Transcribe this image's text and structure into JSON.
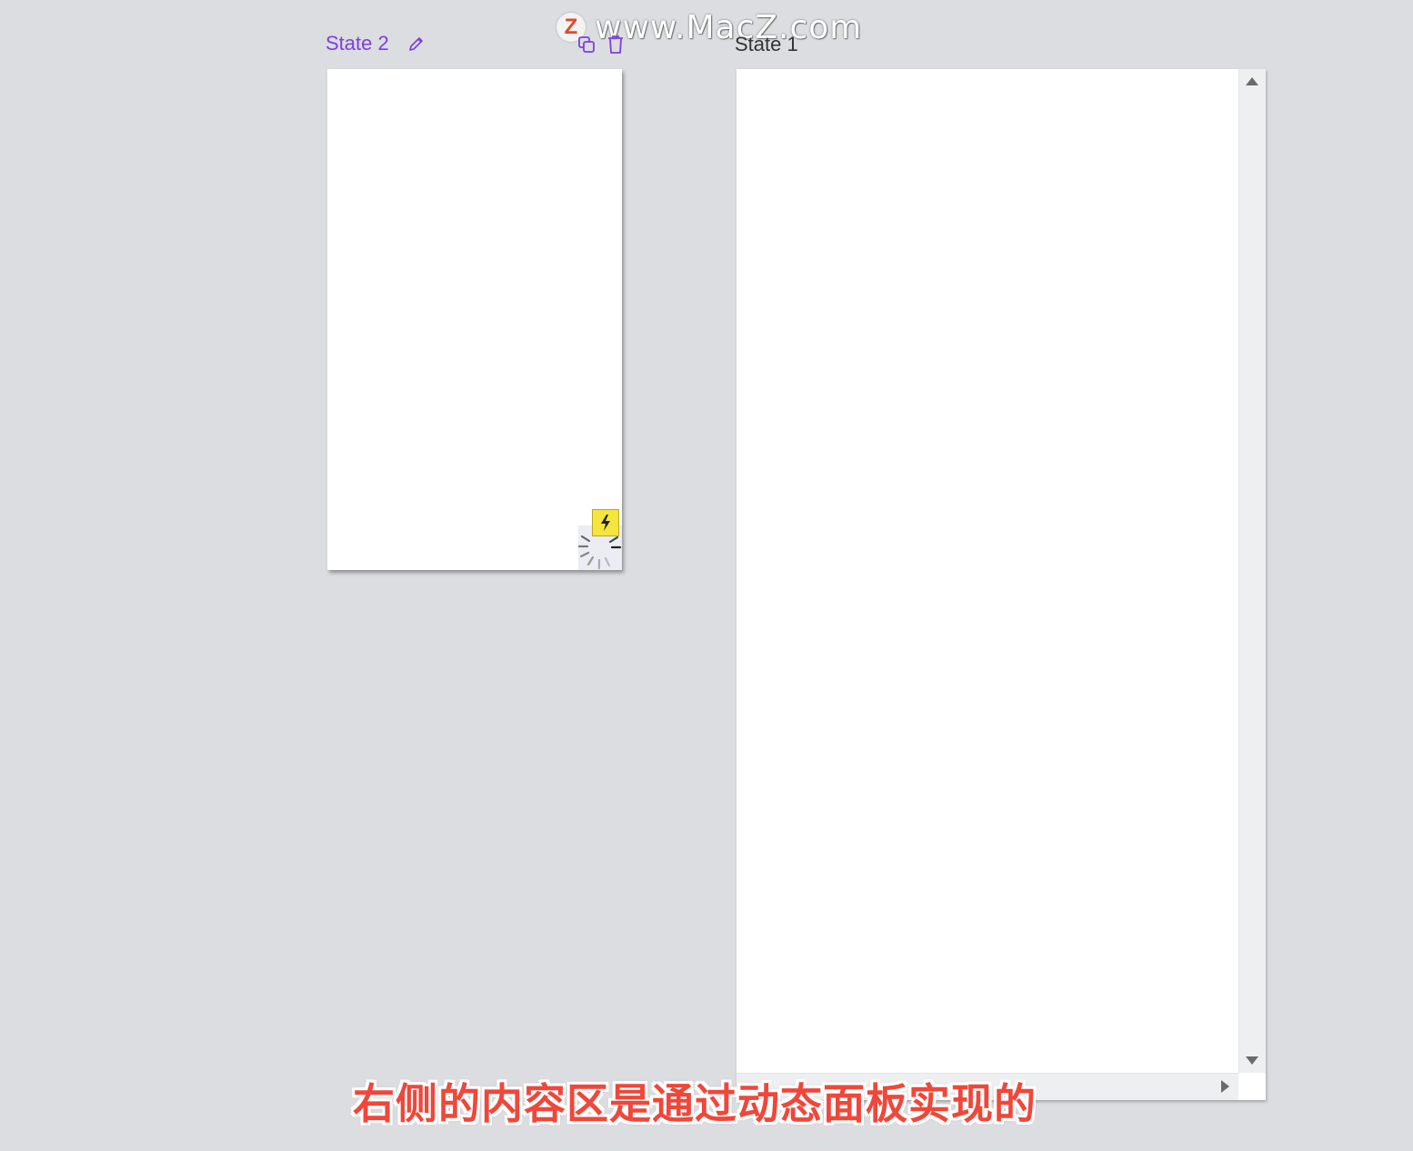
{
  "watermark": {
    "logo_letter": "Z",
    "text": "www.MacZ.com"
  },
  "state2": {
    "title": "State 2"
  },
  "state1": {
    "title": "State 1"
  },
  "subtitle": "右侧的内容区是通过动态面板实现的",
  "colors": {
    "accent": "#7b3fe0",
    "subtitle": "#f0473a",
    "badge": "#f6e53c",
    "canvas": "#dcdde0"
  }
}
